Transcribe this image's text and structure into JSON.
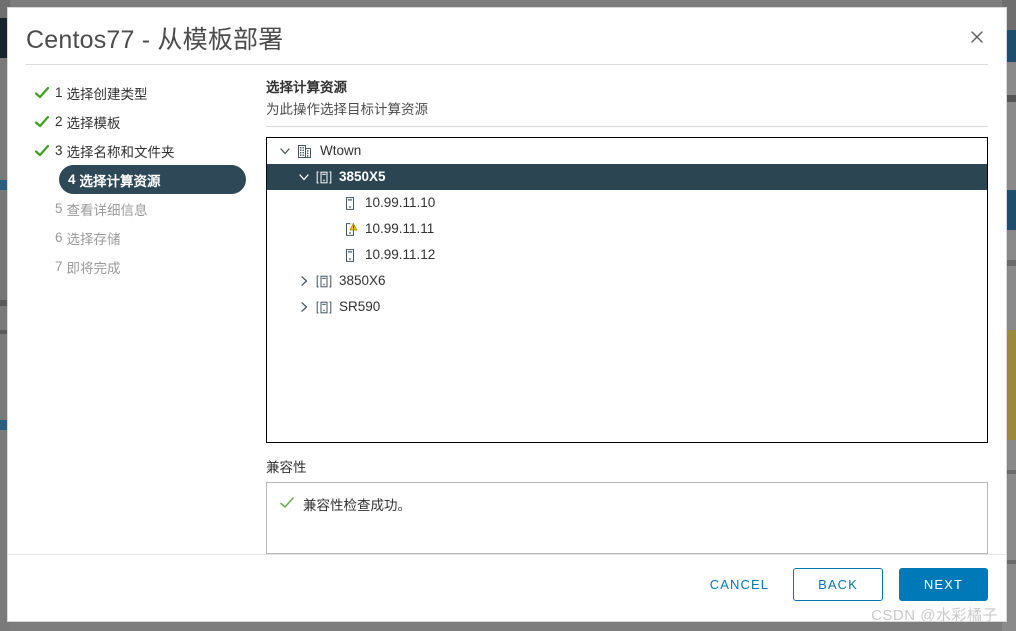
{
  "window": {
    "title": "Centos77 - 从模板部署",
    "close_icon": "close-icon"
  },
  "steps": [
    {
      "num": "1",
      "label": "选择创建类型",
      "state": "done"
    },
    {
      "num": "2",
      "label": "选择模板",
      "state": "done"
    },
    {
      "num": "3",
      "label": "选择名称和文件夹",
      "state": "done"
    },
    {
      "num": "4",
      "label": "选择计算资源",
      "state": "active"
    },
    {
      "num": "5",
      "label": "查看详细信息",
      "state": "pending"
    },
    {
      "num": "6",
      "label": "选择存储",
      "state": "pending"
    },
    {
      "num": "7",
      "label": "即将完成",
      "state": "pending"
    }
  ],
  "panel": {
    "title": "选择计算资源",
    "subtitle": "为此操作选择目标计算资源"
  },
  "tree": [
    {
      "label": "Wtown",
      "level": 0,
      "icon": "datacenter-icon",
      "twisty": "expanded",
      "selected": false,
      "warning": false
    },
    {
      "label": "3850X5",
      "level": 1,
      "icon": "cluster-icon",
      "twisty": "expanded",
      "selected": true,
      "warning": false
    },
    {
      "label": "10.99.11.10",
      "level": 2,
      "icon": "host-icon",
      "twisty": "none",
      "selected": false,
      "warning": false
    },
    {
      "label": "10.99.11.11",
      "level": 2,
      "icon": "host-icon",
      "twisty": "none",
      "selected": false,
      "warning": true
    },
    {
      "label": "10.99.11.12",
      "level": 2,
      "icon": "host-icon",
      "twisty": "none",
      "selected": false,
      "warning": false
    },
    {
      "label": "3850X6",
      "level": 1,
      "icon": "cluster-icon",
      "twisty": "collapsed",
      "selected": false,
      "warning": false
    },
    {
      "label": "SR590",
      "level": 1,
      "icon": "cluster-icon",
      "twisty": "collapsed",
      "selected": false,
      "warning": false
    }
  ],
  "compatibility": {
    "label": "兼容性",
    "status_icon": "check-icon",
    "message": "兼容性检查成功。"
  },
  "footer": {
    "cancel_label": "CANCEL",
    "back_label": "BACK",
    "next_label": "NEXT"
  },
  "watermark": {
    "text": "CSDN @水彩橘子"
  },
  "colors": {
    "accent_blue": "#0079b8",
    "selected_navy": "#2b4552",
    "step_active_navy": "#2e4858",
    "check_green": "#5aa721",
    "warning_yellow": "#f5c400"
  }
}
